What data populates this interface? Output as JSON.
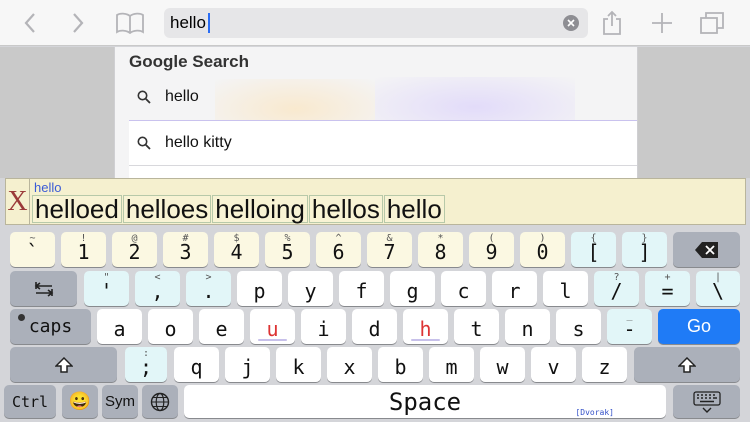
{
  "toolbar": {
    "url_value": "hello"
  },
  "suggestions": {
    "header": "Google Search",
    "items": [
      {
        "text": "hello"
      },
      {
        "text": "hello kitty"
      }
    ]
  },
  "candidates": {
    "close_label": "X",
    "typed": "hello",
    "words": [
      "helloed",
      "helloes",
      "helloing",
      "hellos",
      "hello"
    ]
  },
  "keyboard": {
    "layout_name": "[Dvorak]",
    "row1": [
      {
        "alt": "~",
        "main": "`"
      },
      {
        "alt": "!",
        "main": "1"
      },
      {
        "alt": "@",
        "main": "2"
      },
      {
        "alt": "#",
        "main": "3"
      },
      {
        "alt": "$",
        "main": "4"
      },
      {
        "alt": "%",
        "main": "5"
      },
      {
        "alt": "^",
        "main": "6"
      },
      {
        "alt": "&",
        "main": "7"
      },
      {
        "alt": "*",
        "main": "8"
      },
      {
        "alt": "(",
        "main": "9"
      },
      {
        "alt": ")",
        "main": "0"
      },
      {
        "alt": "{",
        "main": "["
      },
      {
        "alt": "}",
        "main": "]"
      }
    ],
    "row2": [
      {
        "alt": "\"",
        "main": "'"
      },
      {
        "alt": "<",
        "main": ","
      },
      {
        "alt": ">",
        "main": "."
      },
      {
        "alt": "",
        "main": "p"
      },
      {
        "alt": "",
        "main": "y"
      },
      {
        "alt": "",
        "main": "f"
      },
      {
        "alt": "",
        "main": "g"
      },
      {
        "alt": "",
        "main": "c"
      },
      {
        "alt": "",
        "main": "r"
      },
      {
        "alt": "",
        "main": "l"
      },
      {
        "alt": "?",
        "main": "/"
      },
      {
        "alt": "+",
        "main": "="
      },
      {
        "alt": "|",
        "main": "\\"
      }
    ],
    "caps_label": "caps",
    "row3": [
      {
        "main": "a"
      },
      {
        "main": "o"
      },
      {
        "main": "e"
      },
      {
        "main": "u"
      },
      {
        "main": "i"
      },
      {
        "main": "d"
      },
      {
        "main": "h"
      },
      {
        "main": "t"
      },
      {
        "main": "n"
      },
      {
        "main": "s"
      },
      {
        "alt": "_",
        "main": "-"
      }
    ],
    "go_label": "Go",
    "row4": [
      {
        "alt": ":",
        "main": ";"
      },
      {
        "main": "q"
      },
      {
        "main": "j"
      },
      {
        "main": "k"
      },
      {
        "main": "x"
      },
      {
        "main": "b"
      },
      {
        "main": "m"
      },
      {
        "main": "w"
      },
      {
        "main": "v"
      },
      {
        "main": "z"
      }
    ],
    "ctrl_label": "Ctrl",
    "emoji_label": "😀",
    "sym_label": "Sym",
    "space_label": "Space"
  },
  "colors": {
    "go_key": "#1f7bf6",
    "highlight_letter": "#dd3333",
    "candidate_bar": "#f5f0cf"
  }
}
